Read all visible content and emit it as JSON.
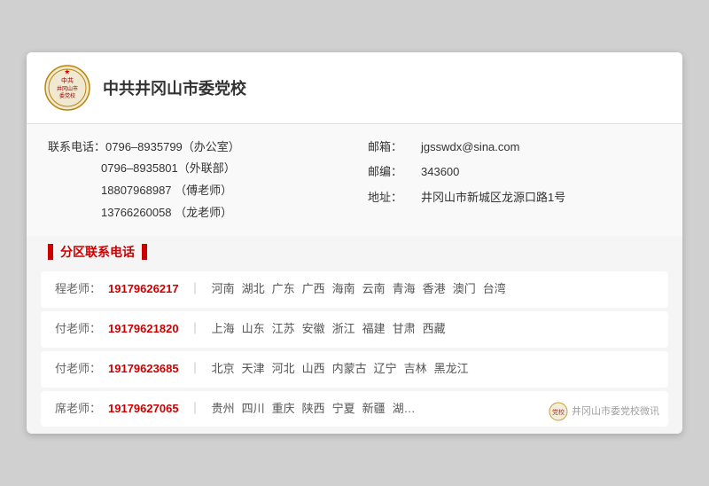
{
  "header": {
    "title": "中共井冈山市委党校",
    "logo_alt": "party-school-logo"
  },
  "contact": {
    "phone_label": "联系电话：",
    "phone1": "0796–8935799（办公室）",
    "phone2": "0796–8935801（外联部）",
    "phone3": "18807968987  （傅老师）",
    "phone4": "13766260058  （龙老师）",
    "email_label": "邮箱：",
    "email": "jgsswdx@sina.com",
    "postcode_label": "邮编：",
    "postcode": "343600",
    "address_label": "地址：",
    "address": "井冈山市新城区龙源口路1号"
  },
  "divider": {
    "text": "分区联系电话"
  },
  "regions": [
    {
      "teacher": "程老师：",
      "phone": "19179626217",
      "areas": [
        "河南",
        "湖北",
        "广东",
        "广西",
        "海南",
        "云南",
        "青海",
        "香港",
        "澳门",
        "台湾"
      ]
    },
    {
      "teacher": "付老师：",
      "phone": "19179621820",
      "areas": [
        "上海",
        "山东",
        "江苏",
        "安徽",
        "浙江",
        "福建",
        "甘肃",
        "西藏"
      ]
    },
    {
      "teacher": "付老师：",
      "phone": "19179623685",
      "areas": [
        "北京",
        "天津",
        "河北",
        "山西",
        "内蒙古",
        "辽宁",
        "吉林",
        "黑龙江"
      ]
    },
    {
      "teacher": "席老师：",
      "phone": "19179627065",
      "areas": [
        "贵州",
        "四川",
        "重庆",
        "陕西",
        "宁夏",
        "新疆",
        "湖…"
      ]
    }
  ],
  "watermark": {
    "text": "井冈山市委党校微讯"
  }
}
